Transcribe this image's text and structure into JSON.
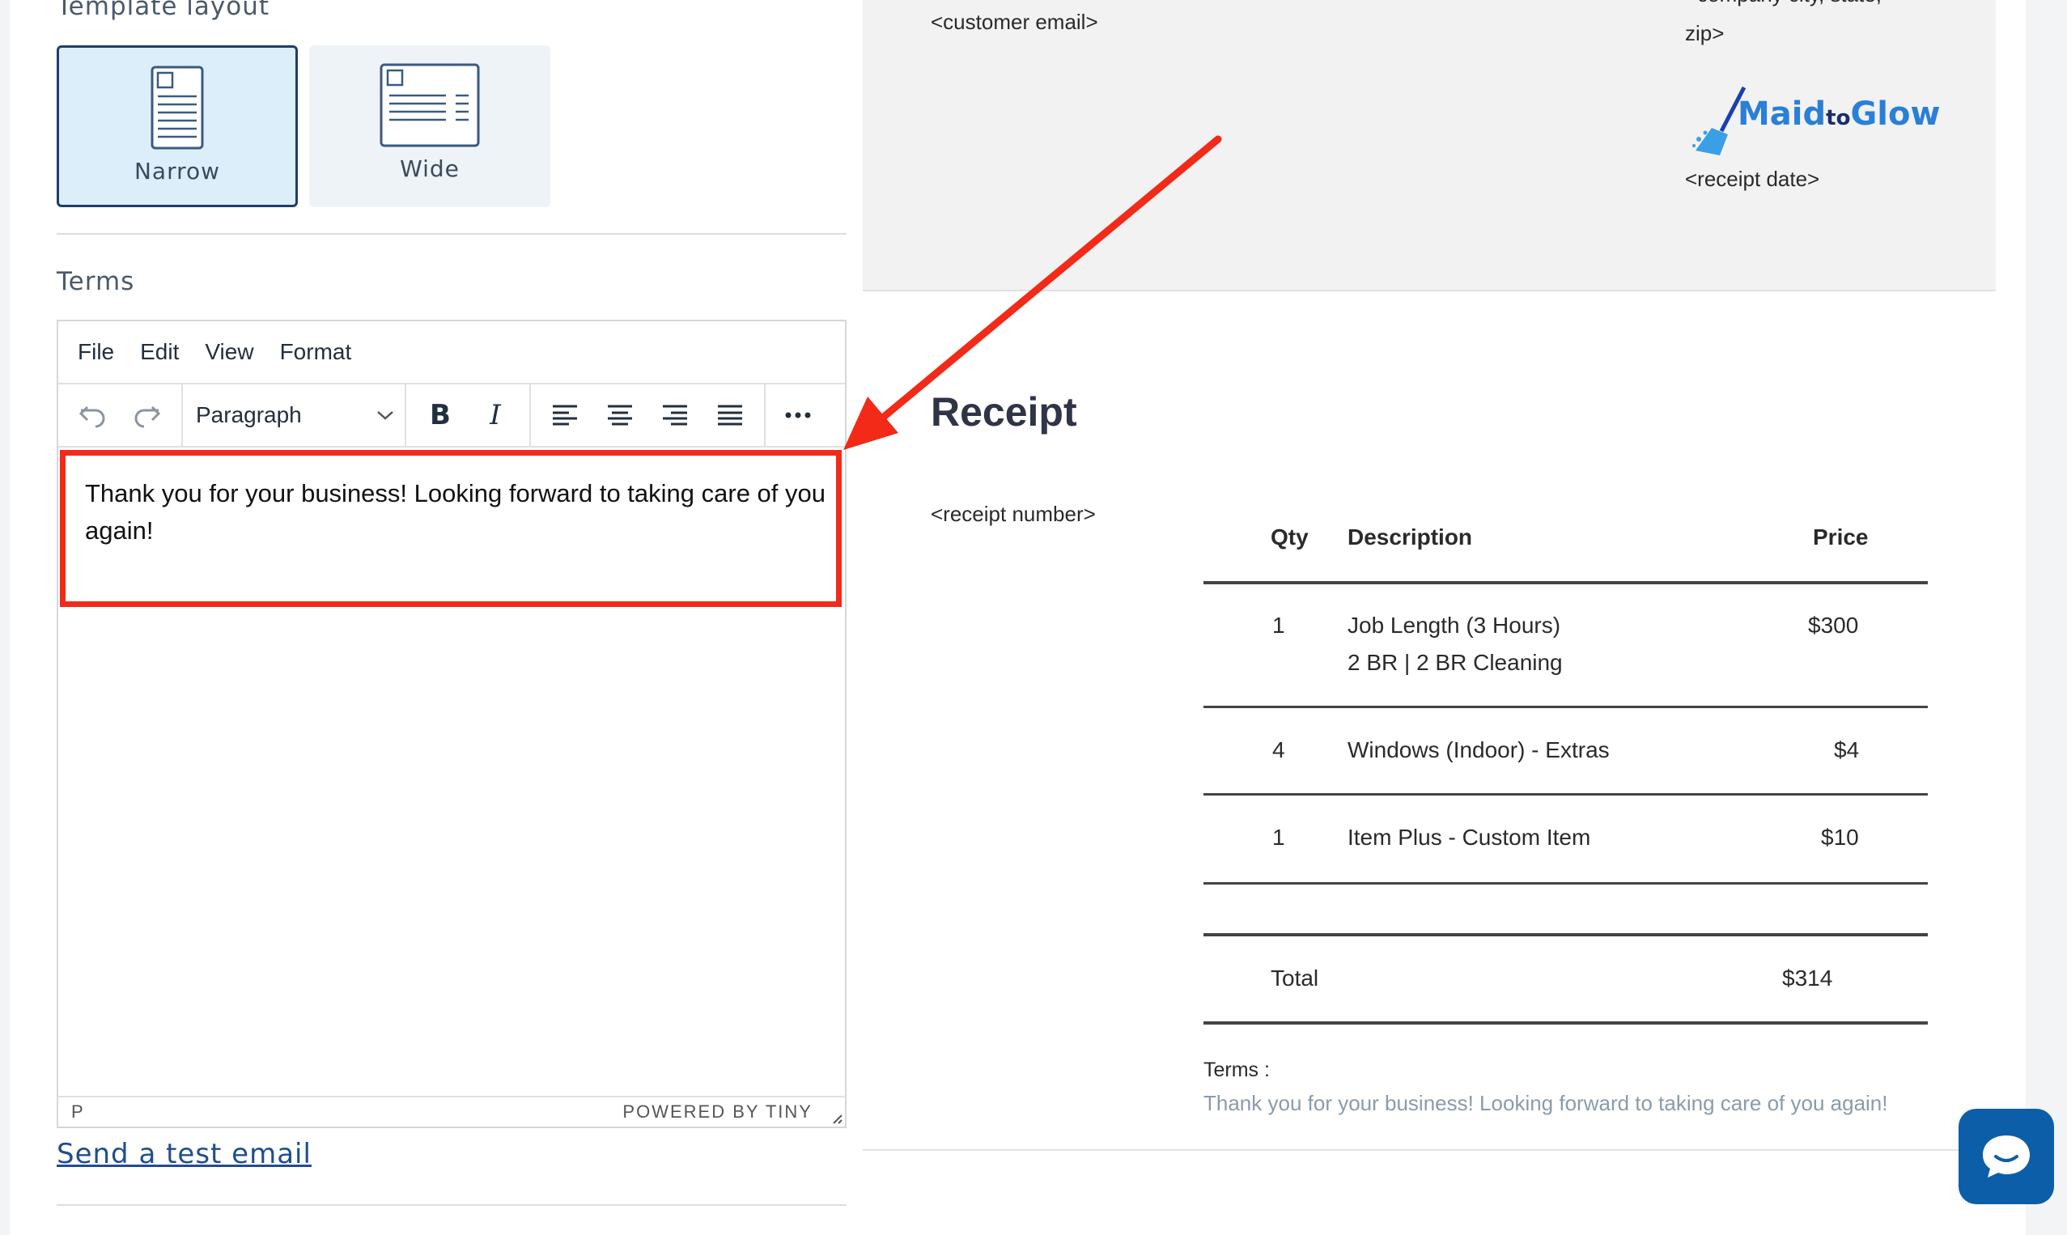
{
  "settings": {
    "template_layout_label": "Template layout",
    "layout_options": [
      {
        "label": "Narrow",
        "selected": true
      },
      {
        "label": "Wide",
        "selected": false
      }
    ],
    "terms_label": "Terms",
    "send_test_email": "Send a test email"
  },
  "editor": {
    "menu": [
      "File",
      "Edit",
      "View",
      "Format"
    ],
    "block_format": "Paragraph",
    "content": "Thank you for your business! Looking forward to taking care of you again!",
    "status_path": "P",
    "powered_by": "POWERED BY TINY"
  },
  "preview": {
    "customer_email": "<customer email>",
    "company_city_line": "<company city, state,",
    "company_zip_line": "zip>",
    "logo_text_main": "Maid",
    "logo_text_to": "to",
    "logo_text_glow": "Glow",
    "receipt_date": "<receipt date>",
    "title": "Receipt",
    "receipt_number": "<receipt number>",
    "table": {
      "headers": {
        "qty": "Qty",
        "description": "Description",
        "price": "Price"
      },
      "rows": [
        {
          "qty": "1",
          "description_line1": "Job Length (3 Hours)",
          "description_line2": "2 BR | 2 BR Cleaning",
          "price": "$300"
        },
        {
          "qty": "4",
          "description_line1": "Windows (Indoor) - Extras",
          "description_line2": "",
          "price": "$4"
        },
        {
          "qty": "1",
          "description_line1": "Item Plus - Custom Item",
          "description_line2": "",
          "price": "$10"
        }
      ],
      "total_label": "Total",
      "total_value": "$314"
    },
    "terms_label": "Terms :",
    "terms_text": "Thank you for your business! Looking forward to taking care of you again!"
  },
  "colors": {
    "annotation": "#f22a17",
    "accent": "#1f3d6a",
    "chat_button": "#0d5ea8"
  }
}
